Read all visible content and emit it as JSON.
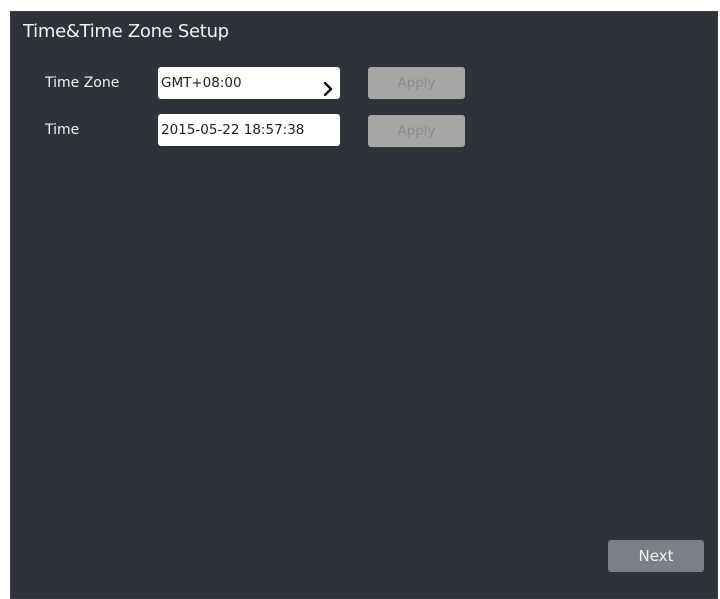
{
  "dialog": {
    "title": "Time&Time Zone Setup"
  },
  "time_zone": {
    "label": "Time Zone",
    "value": "GMT+08:00",
    "apply_label": "Apply"
  },
  "time": {
    "label": "Time",
    "value": "2015-05-22 18:57:38",
    "apply_label": "Apply"
  },
  "footer": {
    "next_label": "Next"
  },
  "colors": {
    "background": "#30323a",
    "apply_disabled": "#a6a6a6",
    "next_button": "#7b7f86"
  },
  "icons": {
    "dropdown": "chevron-right-icon"
  }
}
